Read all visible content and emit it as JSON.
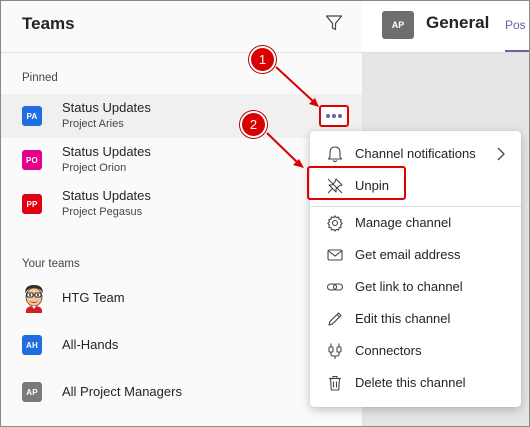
{
  "colors": {
    "accent": "#6264a7",
    "callout_red": "#d80000",
    "tile_pa": "#1f6fe0",
    "tile_po": "#e3008c",
    "tile_pp": "#e30014",
    "tile_ah": "#1f6fe0",
    "tile_ap": "#7a7a7a"
  },
  "sidebar": {
    "title": "Teams",
    "filter_icon": "filter-icon",
    "pinned_label": "Pinned",
    "pinned": [
      {
        "initials": "PA",
        "title": "Status Updates",
        "subtitle": "Project Aries"
      },
      {
        "initials": "PO",
        "title": "Status Updates",
        "subtitle": "Project Orion"
      },
      {
        "initials": "PP",
        "title": "Status Updates",
        "subtitle": "Project Pegasus"
      }
    ],
    "teams_label": "Your teams",
    "teams": [
      {
        "avatar": "cartoon-avatar",
        "name": "HTG Team"
      },
      {
        "initials": "AH",
        "name": "All-Hands"
      },
      {
        "initials": "AP",
        "name": "All Project Managers"
      }
    ]
  },
  "main": {
    "avatar_initials": "AP",
    "title": "General",
    "tab_label": "Pos"
  },
  "context_menu": {
    "items": [
      {
        "icon": "bell-icon",
        "label": "Channel notifications",
        "has_submenu": true
      },
      {
        "icon": "unpin-icon",
        "label": "Unpin"
      },
      {
        "icon": "gear-icon",
        "label": "Manage channel"
      },
      {
        "icon": "mail-icon",
        "label": "Get email address"
      },
      {
        "icon": "link-icon",
        "label": "Get link to channel"
      },
      {
        "icon": "pencil-icon",
        "label": "Edit this channel"
      },
      {
        "icon": "connectors-icon",
        "label": "Connectors"
      },
      {
        "icon": "trash-icon",
        "label": "Delete this channel"
      }
    ]
  },
  "callouts": [
    {
      "number": "1"
    },
    {
      "number": "2"
    }
  ]
}
